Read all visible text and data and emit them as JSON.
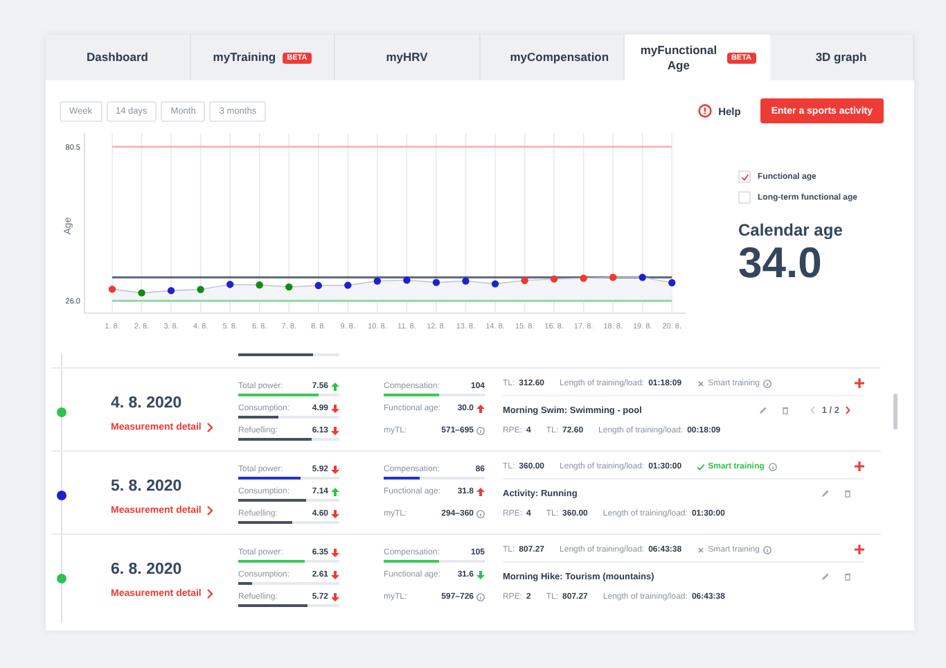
{
  "tabs": [
    {
      "label": "Dashboard",
      "selected": false
    },
    {
      "label": "myTraining",
      "badge": "BETA",
      "selected": false
    },
    {
      "label": "myHRV",
      "selected": false
    },
    {
      "label": "myCompensation",
      "selected": false
    },
    {
      "label": "myFunctional Age",
      "badge": "BETA",
      "selected": true
    },
    {
      "label": "3D graph",
      "selected": false
    }
  ],
  "ranges": [
    "Week",
    "14 days",
    "Month",
    "3 months"
  ],
  "help": "Help",
  "primary_button": "Enter a sports activity",
  "chart": {
    "chart_data": {
      "type": "line",
      "ylabel": "Age",
      "categories": [
        "1. 8.",
        "2. 8.",
        "3. 8.",
        "4. 8.",
        "5. 8.",
        "6. 8.",
        "7. 8.",
        "8. 8.",
        "9. 8.",
        "10. 8.",
        "11. 8.",
        "12. 8.",
        "13. 8.",
        "14. 8.",
        "15. 8.",
        "16. 8.",
        "17. 8.",
        "18. 8.",
        "19. 8.",
        "20. 8."
      ],
      "series": [
        {
          "color": "#c3c8d0",
          "marker": "circle",
          "values": [
            30.1,
            28.8,
            29.6,
            30.0,
            31.8,
            31.6,
            30.9,
            31.4,
            31.5,
            33.0,
            33.3,
            32.5,
            33.0,
            32.0,
            33.2,
            33.7,
            34.0,
            34.3,
            34.3,
            32.4
          ]
        }
      ],
      "grid": true,
      "ylim": [
        21.6,
        85.4
      ],
      "yticks": [
        {
          "value": 26,
          "label": "26.0"
        },
        {
          "value": 80.5,
          "label": "80.5"
        }
      ],
      "ref_lines": [
        {
          "axis": "y",
          "value": 80.5,
          "color": "#f6b3b3"
        },
        {
          "axis": "y",
          "value": 26,
          "color": "#8ad89a"
        },
        {
          "axis": "y",
          "value": 34.3,
          "color": "#5b6578"
        }
      ]
    },
    "points": [
      {
        "color": "#f0392f"
      },
      {
        "color": "#138a13"
      },
      {
        "color": "#1f22c9"
      },
      {
        "color": "#138a13"
      },
      {
        "color": "#1f22c9"
      },
      {
        "color": "#138a13"
      },
      {
        "color": "#138a13"
      },
      {
        "color": "#1f22c9"
      },
      {
        "color": "#1f22c9"
      },
      {
        "color": "#1f22c9"
      },
      {
        "color": "#1f22c9"
      },
      {
        "color": "#1f22c9"
      },
      {
        "color": "#1f22c9"
      },
      {
        "color": "#1f22c9"
      },
      {
        "color": "#f0392f"
      },
      {
        "color": "#f0392f"
      },
      {
        "color": "#f0392f"
      },
      {
        "color": "#f0392f"
      },
      {
        "color": "#1f22c9"
      },
      {
        "color": "#1f22c9"
      }
    ]
  },
  "legend": [
    {
      "label": "Functional age",
      "checked": true
    },
    {
      "label": "Long-term functional age",
      "checked": false
    }
  ],
  "calendar_age": {
    "label": "Calendar age",
    "value": "34.0"
  },
  "previous_row_bar": {
    "level": 0.74
  },
  "days": [
    {
      "date": "4. 8. 2020",
      "link": "Measurement detail",
      "color": "#2fc24f",
      "metrics": [
        {
          "label": "Total power:",
          "value": "7.56",
          "rising": true,
          "good": true,
          "level": 0.79,
          "color": "#3ec95c"
        },
        {
          "label": "Consumption:",
          "value": "4.99",
          "rising": false,
          "good": false,
          "level": 0.4,
          "color": "#47505e"
        },
        {
          "label": "Refuelling:",
          "value": "6.13",
          "rising": false,
          "good": false,
          "level": 0.73,
          "color": "#47505e"
        }
      ],
      "compensation": {
        "label": "Compensation:",
        "value": "104",
        "level": 0.55,
        "color": "#3ec95c"
      },
      "functional_age": {
        "label": "Functional age:",
        "value": "30.0",
        "rising": true,
        "good": false
      },
      "mytl": {
        "label": "myTL:",
        "value": "571–695"
      },
      "summary": {
        "tl_label": "TL:",
        "tl": "312.60",
        "length_label": "Length of training/load:",
        "length": "01:18:09",
        "smart": false,
        "smart_label": "Smart training"
      },
      "activity": {
        "name": "Morning Swim: Swimming - pool",
        "rpe_label": "RPE:",
        "rpe": "4",
        "tl_label": "TL:",
        "tl": "72.60",
        "length_label": "Length of training/load:",
        "length": "00:18:09",
        "pager": "1 / 2"
      }
    },
    {
      "date": "5. 8. 2020",
      "link": "Measurement detail",
      "color": "#1f22c9",
      "metrics": [
        {
          "label": "Total power:",
          "value": "5.92",
          "rising": false,
          "good": false,
          "level": 0.62,
          "color": "#2a2fd0"
        },
        {
          "label": "Consumption:",
          "value": "7.14",
          "rising": true,
          "good": true,
          "level": 0.67,
          "color": "#47505e"
        },
        {
          "label": "Refuelling:",
          "value": "4.60",
          "rising": false,
          "good": false,
          "level": 0.54,
          "color": "#47505e"
        }
      ],
      "compensation": {
        "label": "Compensation:",
        "value": "86",
        "level": 0.35,
        "color": "#2a2fd0"
      },
      "functional_age": {
        "label": "Functional age:",
        "value": "31.8",
        "rising": true,
        "good": false
      },
      "mytl": {
        "label": "myTL:",
        "value": "294–360"
      },
      "summary": {
        "tl_label": "TL:",
        "tl": "360.00",
        "length_label": "Length of training/load:",
        "length": "01:30:00",
        "smart": true,
        "smart_label": "Smart training"
      },
      "activity": {
        "name": "Activity: Running",
        "rpe_label": "RPE:",
        "rpe": "4",
        "tl_label": "TL:",
        "tl": "360.00",
        "length_label": "Length of training/load:",
        "length": "01:30:00"
      }
    },
    {
      "date": "6. 8. 2020",
      "link": "Measurement detail",
      "color": "#2fc24f",
      "metrics": [
        {
          "label": "Total power:",
          "value": "6.35",
          "rising": false,
          "good": false,
          "level": 0.66,
          "color": "#3ec95c"
        },
        {
          "label": "Consumption:",
          "value": "2.61",
          "rising": false,
          "good": false,
          "level": 0.14,
          "color": "#47505e"
        },
        {
          "label": "Refuelling:",
          "value": "5.72",
          "rising": false,
          "good": false,
          "level": 0.68,
          "color": "#47505e"
        }
      ],
      "compensation": {
        "label": "Compensation:",
        "value": "105",
        "level": 0.55,
        "color": "#3ec95c"
      },
      "functional_age": {
        "label": "Functional age:",
        "value": "31.6",
        "rising": false,
        "good": true
      },
      "mytl": {
        "label": "myTL:",
        "value": "597–726"
      },
      "summary": {
        "tl_label": "TL:",
        "tl": "807.27",
        "length_label": "Length of training/load:",
        "length": "06:43:38",
        "smart": false,
        "smart_label": "Smart training"
      },
      "activity": {
        "name": "Morning Hike: Tourism (mountains)",
        "rpe_label": "RPE:",
        "rpe": "2",
        "tl_label": "TL:",
        "tl": "807.27",
        "length_label": "Length of training/load:",
        "length": "06:43:38"
      }
    }
  ]
}
